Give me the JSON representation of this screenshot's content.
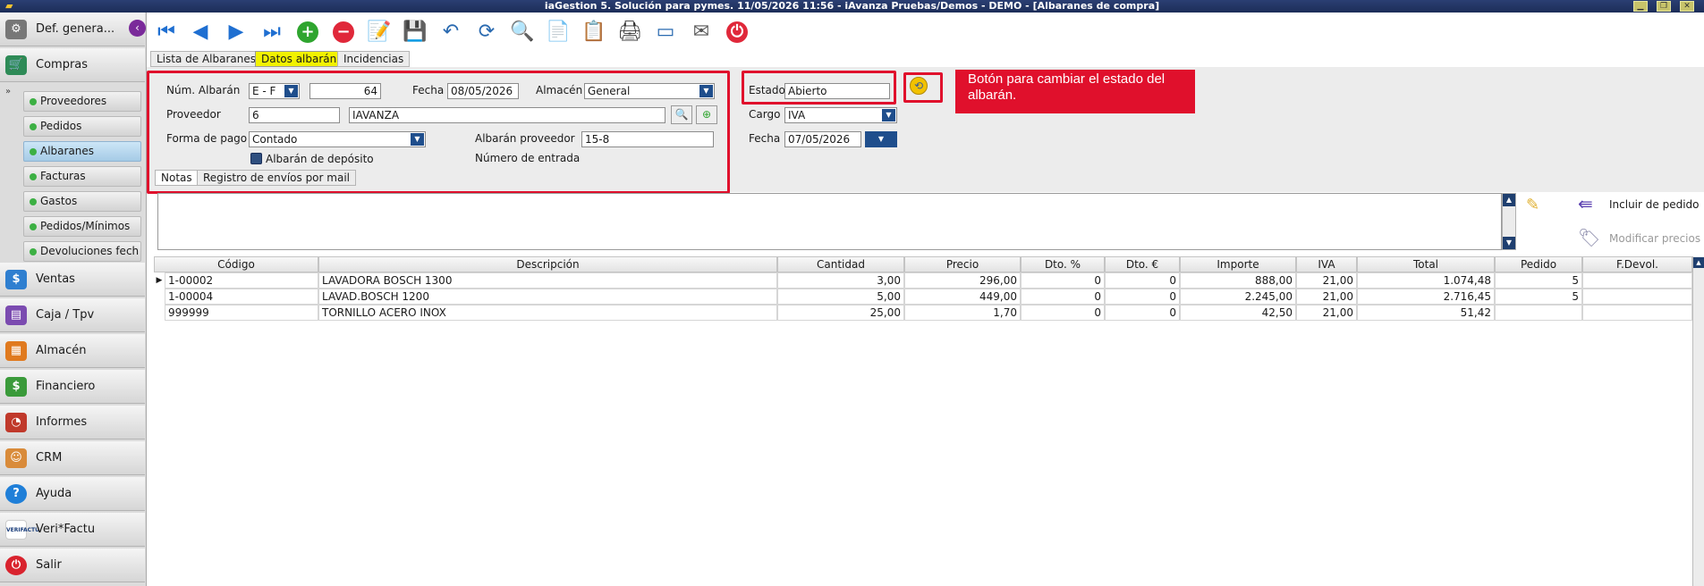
{
  "titlebar": {
    "title": "iaGestion 5. Solución para pymes.  11/05/2026 11:56  -  iAvanza Pruebas/Demos - DEMO - [Albaranes de compra]"
  },
  "sidebar": {
    "def_general": "Def. genera...",
    "compras": "Compras",
    "sub": [
      "Proveedores",
      "Pedidos",
      "Albaranes",
      "Facturas",
      "Gastos",
      "Pedidos/Mínimos",
      "Devoluciones fech"
    ],
    "sections": [
      "Ventas",
      "Caja / Tpv",
      "Almacén",
      "Financiero",
      "Informes",
      "CRM",
      "Ayuda",
      "Veri*Factu",
      "Salir"
    ],
    "verifactu_logo_text": "VERIFACTU"
  },
  "tabs": [
    "Lista de Albaranes",
    "Datos albarán",
    "Incidencias"
  ],
  "form": {
    "num_albaran_label": "Núm. Albarán",
    "serie": "E  - F",
    "numero": "64",
    "fecha_label": "Fecha",
    "fecha": "08/05/2026",
    "almacen_label": "Almacén",
    "almacen": "General",
    "proveedor_label": "Proveedor",
    "proveedor_codigo": "6",
    "proveedor_nombre": "IAVANZA",
    "forma_pago_label": "Forma de pago",
    "forma_pago": "Contado",
    "albaran_proveedor_label": "Albarán proveedor",
    "albaran_proveedor": "15-8",
    "deposito_label": "Albarán de depósito",
    "numero_entrada_label": "Número de entrada",
    "estado_label": "Estado",
    "estado": "Abierto",
    "cargo_label": "Cargo",
    "cargo": "IVA",
    "fecha2_label": "Fecha",
    "fecha2": "07/05/2026"
  },
  "annotation": {
    "text": "Botón para cambiar el estado del albarán."
  },
  "subtabs": [
    "Notas",
    "Registro de envíos por mail"
  ],
  "side_actions": {
    "incluir": "Incluir de pedido",
    "modificar": "Modificar precios"
  },
  "grid": {
    "headers": [
      "Código",
      "Descripción",
      "Cantidad",
      "Precio",
      "Dto. %",
      "Dto. €",
      "Importe",
      "IVA",
      "Total",
      "Pedido",
      "F.Devol."
    ],
    "rows": [
      [
        "1-00002",
        "LAVADORA BOSCH 1300",
        "3,00",
        "296,00",
        "0",
        "0",
        "888,00",
        "21,00",
        "1.074,48",
        "5",
        ""
      ],
      [
        "1-00004",
        "LAVAD.BOSCH 1200",
        "5,00",
        "449,00",
        "0",
        "0",
        "2.245,00",
        "21,00",
        "2.716,45",
        "5",
        ""
      ],
      [
        "999999",
        "TORNILLO ACERO INOX",
        "25,00",
        "1,70",
        "0",
        "0",
        "42,50",
        "21,00",
        "51,42",
        "",
        ""
      ]
    ]
  },
  "colors": {
    "accent_red": "#e0102c",
    "title_bar": "#1d2d58",
    "tab_selected": "#f2f200"
  }
}
